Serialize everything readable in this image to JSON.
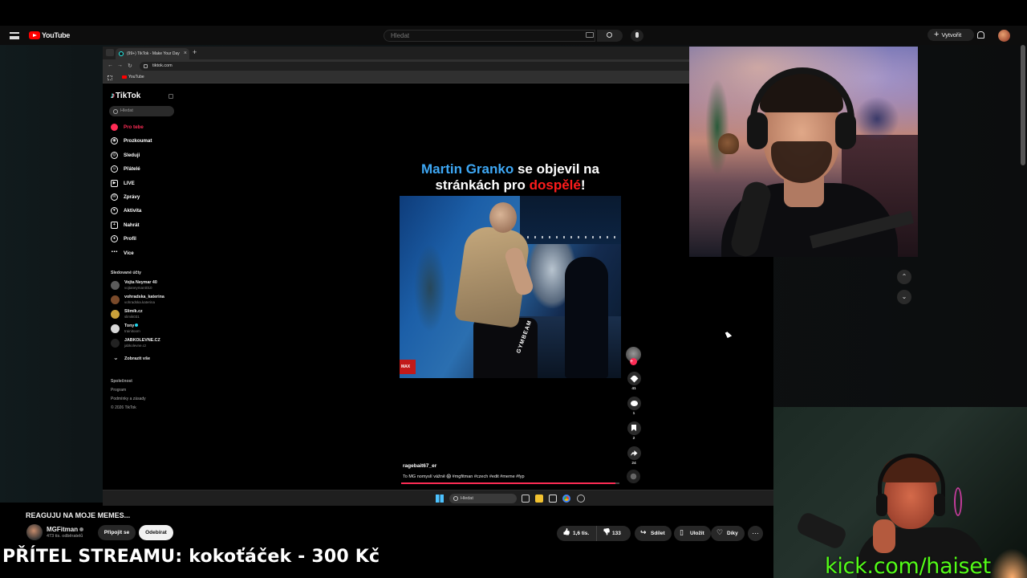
{
  "youtube": {
    "logo_text": "YouTube",
    "search_placeholder": "Hledat",
    "create_label": "Vytvořit",
    "video_title": "REAGUJU NA MOJE MEMES...",
    "channel_name": "MGFitman",
    "channel_subs": "473 tis. odběratelů",
    "join_label": "Připojit se",
    "subscribe_label": "Odebírat",
    "likes": "1,6 tis.",
    "dislikes": "133",
    "share_label": "Sdílet",
    "save_label": "Uložit",
    "thanks_label": "Díky"
  },
  "browser": {
    "tab_title": "(99+) TikTok - Make Your Day",
    "url": "tiktok.com",
    "bookmark": "YouTube"
  },
  "tiktok": {
    "logo_text": "TikTok",
    "search_placeholder": "Hledat",
    "nav": [
      {
        "label": "Pro tebe",
        "icon": "home-icon"
      },
      {
        "label": "Prozkoumat",
        "icon": "compass-icon"
      },
      {
        "label": "Sleduji",
        "icon": "following-icon"
      },
      {
        "label": "Přátelé",
        "icon": "friends-icon"
      },
      {
        "label": "LIVE",
        "icon": "live-icon"
      },
      {
        "label": "Zprávy",
        "icon": "messages-icon"
      },
      {
        "label": "Aktivita",
        "icon": "activity-icon"
      },
      {
        "label": "Nahrát",
        "icon": "upload-icon"
      },
      {
        "label": "Profil",
        "icon": "profile-icon"
      },
      {
        "label": "Více",
        "icon": "more-icon"
      }
    ],
    "following_title": "Sledované účty",
    "following": [
      {
        "name": "Vojta Neymar 40",
        "handle": "vojtaneymar4010"
      },
      {
        "name": "vohradska_katerina",
        "handle": "vohradska.katerina"
      },
      {
        "name": "Slimík.cz",
        "handle": "slimik031"
      },
      {
        "name": "Tony",
        "handle": "trainitoom"
      },
      {
        "name": "JABKOLEVNE.CZ",
        "handle": "jabkolevne.cz"
      }
    ],
    "show_all": "Zobrazit vše",
    "footer": [
      "Společnost",
      "Program",
      "Podmínky a zásady",
      "© 2026 TikTok"
    ],
    "caption_part1": "Martin Granko",
    "caption_part2": " se objevil na stránkách pro ",
    "caption_part3": "dospělé",
    "caption_part4": "!",
    "frame_tag": "GYMBEAM",
    "frame_logo": "MAX",
    "like_count": "41",
    "comment_count": "1",
    "save_count": "2",
    "share_count": "24",
    "author": "ragebait67_er",
    "description": "To MG nomyslí vážně 😱 #mgfitman #czech #edit #meme #fyp",
    "progress": 0.98
  },
  "taskbar": {
    "search_placeholder": "Hledat"
  },
  "overlay": {
    "donation_text": "PŘÍTEL STREAMU: kokoťáček - 300 Kč",
    "kick_url": "kick.com/haiset"
  }
}
